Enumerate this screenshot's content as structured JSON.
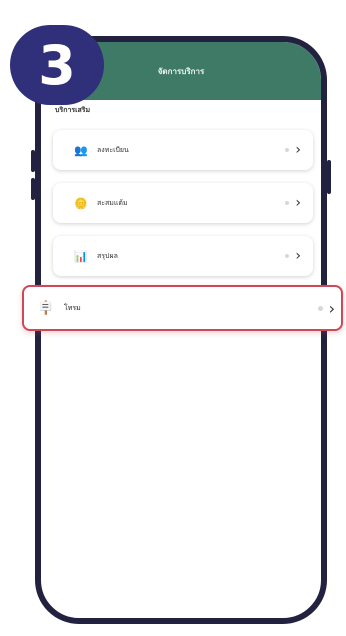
{
  "step": {
    "number": "3"
  },
  "header": {
    "title": "จัดการบริการ"
  },
  "section": {
    "label": "บริการเสริม"
  },
  "items": [
    {
      "label": "ลงทะเบียน",
      "icon": "people-icon",
      "glyph": "👥"
    },
    {
      "label": "สะสมแต้ม",
      "icon": "coins-icon",
      "glyph": "🪙"
    },
    {
      "label": "สรุปผล",
      "icon": "chart-icon",
      "glyph": "📊"
    }
  ],
  "highlight_item": {
    "label": "โทรม",
    "icon": "signpost-icon",
    "glyph": "🪧"
  },
  "chevron": "›",
  "colors": {
    "header": "#3f7a67",
    "badge": "#2f2f7a",
    "highlight_border": "#cc4a57",
    "frame": "#22213f"
  }
}
